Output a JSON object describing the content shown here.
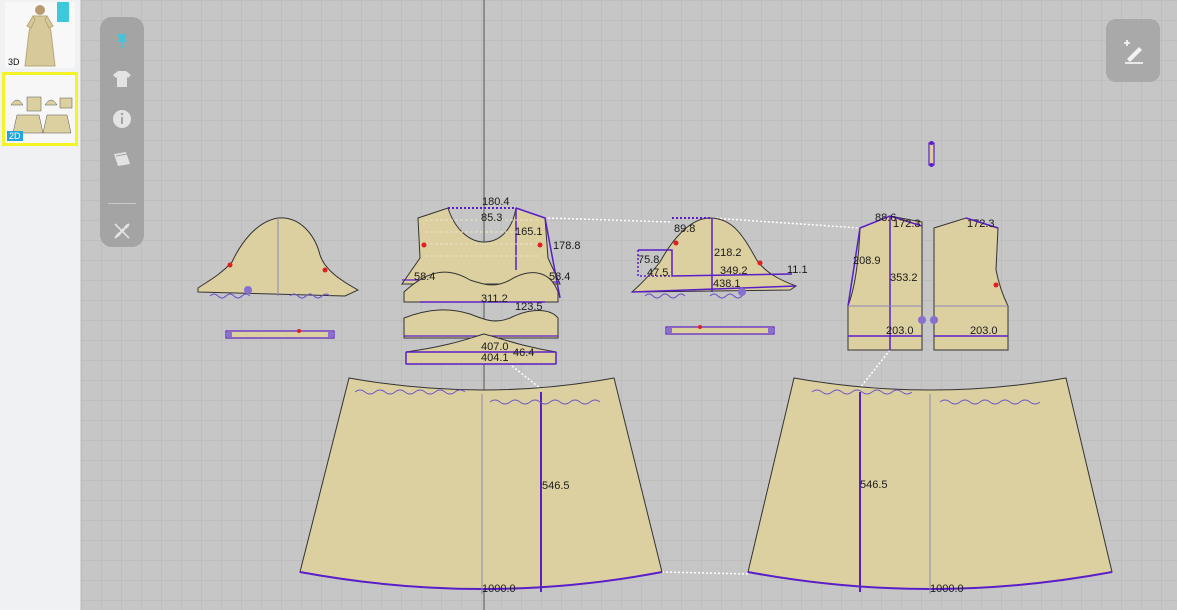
{
  "sidebar": {
    "thumbnails": [
      {
        "label": "3D"
      },
      {
        "label": "2D"
      }
    ]
  },
  "toolbar": {
    "tools": [
      "pin-icon",
      "garment-icon",
      "info-icon",
      "fabric-icon",
      "measure-off-icon"
    ]
  },
  "fab": {
    "icon": "add-edit-icon"
  },
  "colors": {
    "fabric": "#dcd0a0",
    "seam": "#5a1ec8",
    "selection": "#f3f325",
    "accent": "#24a4d8"
  },
  "measurements": {
    "m1": "180.4",
    "m2": "85.3",
    "m3": "165.1",
    "m4": "178.8",
    "m5": "58.4",
    "m6": "58.4",
    "m7": "311.2",
    "m8": "123.5",
    "m9": "407.0",
    "m10": "404.1",
    "m11": "46.4",
    "m12": "89.8",
    "m13": "218.2",
    "m14": "75.8",
    "m15": "47.5",
    "m16": "349.2",
    "m17": "11.1",
    "m18": "438.1",
    "m19": "88.6",
    "m20": "172.3",
    "m21": "172.3",
    "m22": "208.9",
    "m23": "353.2",
    "m24": "203.0",
    "m25": "203.0",
    "m26": "546.5",
    "m27": "546.5",
    "m28": "1000.0",
    "m29": "1000.0"
  }
}
